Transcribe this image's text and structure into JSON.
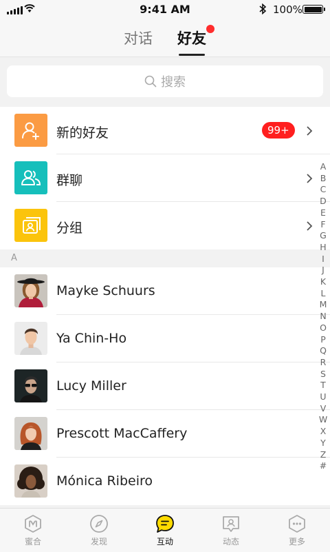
{
  "status_bar": {
    "time": "9:41 AM",
    "battery": "100%",
    "battery_level": 1.0
  },
  "top_tabs": [
    {
      "label": "对话",
      "active": false
    },
    {
      "label": "好友",
      "active": true,
      "has_dot": true
    }
  ],
  "search": {
    "placeholder": "搜索"
  },
  "menu_items": [
    {
      "label": "新的好友",
      "icon": "add-user-icon",
      "color": "#fb9b43",
      "badge": "99+"
    },
    {
      "label": "群聊",
      "icon": "group-icon",
      "color": "#16bfbb"
    },
    {
      "label": "分组",
      "icon": "folder-contacts-icon",
      "color": "#fbc40c"
    }
  ],
  "section_header": "A",
  "contacts": [
    {
      "name": "Mayke Schuurs"
    },
    {
      "name": "Ya Chin-Ho"
    },
    {
      "name": "Lucy Miller"
    },
    {
      "name": "Prescott MacCaffery"
    },
    {
      "name": "Mónica Ribeiro"
    }
  ],
  "alphabet": [
    "A",
    "B",
    "C",
    "D",
    "E",
    "F",
    "G",
    "H",
    "I",
    "J",
    "K",
    "L",
    "M",
    "N",
    "O",
    "P",
    "Q",
    "R",
    "S",
    "T",
    "U",
    "V",
    "W",
    "X",
    "Y",
    "Z",
    "#"
  ],
  "bottom_tabs": [
    {
      "label": "蜜合",
      "icon": "honey-m-icon",
      "active": false
    },
    {
      "label": "发现",
      "icon": "compass-icon",
      "active": false
    },
    {
      "label": "互动",
      "icon": "chat-bubble-icon",
      "active": true
    },
    {
      "label": "动态",
      "icon": "moments-icon",
      "active": false
    },
    {
      "label": "更多",
      "icon": "more-icon",
      "active": false
    }
  ],
  "colors": {
    "accent": "#fedb00",
    "badge": "#ff1f1f",
    "dot": "#ff2d2d"
  }
}
